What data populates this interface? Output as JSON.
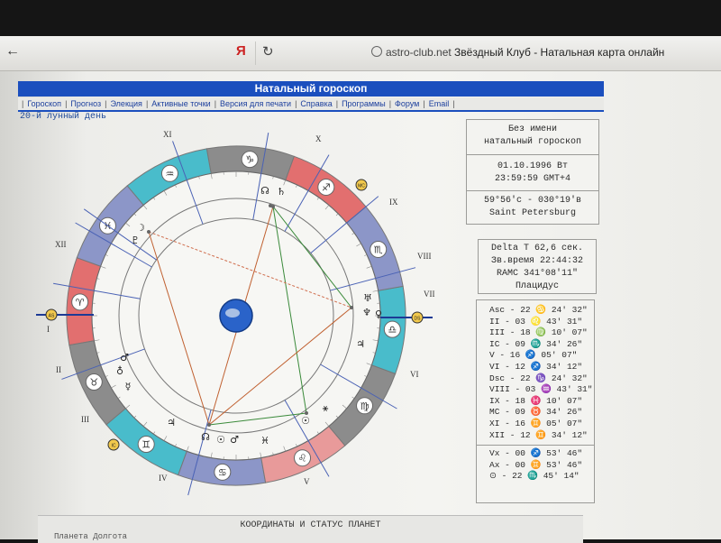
{
  "browser": {
    "title_site": "astro-club.net",
    "title_rest": "Звёздный Клуб - Натальная карта онлайн"
  },
  "page": {
    "title": "Натальный гороскоп",
    "menu": [
      "Гороскоп",
      "Прогноз",
      "Элекция",
      "Активные точки",
      "Версия для печати",
      "Справка",
      "Программы",
      "Форум",
      "Email"
    ],
    "lunar_day": "20-й лунный день"
  },
  "info": {
    "name": "Без имени",
    "type": "натальный гороскоп",
    "date": "01.10.1996 Вт",
    "time": "23:59:59",
    "gmt": "GMT+4",
    "coords": "59°56'с - 030°19'в",
    "city": "Saint Petersburg"
  },
  "astro": {
    "delta_t": "Delta T   62,6 сек.",
    "star_time": "Зв.время 22:44:32",
    "ramc": "RAMC 341°08'11\"",
    "system": "Плацидус"
  },
  "cusps": [
    "Asc - 22 ♋ 24' 32\"",
    "II - 03 ♌ 43' 31\"",
    "III - 18 ♍ 10' 07\"",
    "IC - 09 ♏ 34' 26\"",
    "V - 16 ♐ 05' 07\"",
    "VI - 12 ♐ 34' 12\"",
    "Dsc - 22 ♑ 24' 32\"",
    "VIII - 03 ♒ 43' 31\"",
    "IX - 18 ♓ 10' 07\"",
    "MC - 09 ♉ 34' 26\"",
    "XI - 16 ♊ 05' 07\"",
    "XII - 12 ♊ 34' 12\""
  ],
  "points": [
    "Vx - 00 ♐ 53' 46\"",
    "Ax - 00 ♊ 53' 46\"",
    "⊙ - 22 ♏ 45' 14\""
  ],
  "house_labels": [
    "I",
    "II",
    "III",
    "IV",
    "V",
    "VI",
    "VII",
    "VIII",
    "IX",
    "X",
    "XI",
    "XII"
  ],
  "zodiac_glyphs": [
    "♈",
    "♉",
    "♊",
    "♋",
    "♌",
    "♍",
    "♎",
    "♏",
    "♐",
    "♑",
    "♒",
    "♓"
  ],
  "zodiac_colors": [
    "#e26f6f",
    "#8c8c8c",
    "#49bccb",
    "#8c96c8",
    "#e89a9a",
    "#8c8c8c",
    "#49bccb",
    "#8c96c8",
    "#e26f6f",
    "#8c8c8c",
    "#49bccb",
    "#8c96c8"
  ],
  "chart_marks": {
    "planets_top": [
      "☊",
      "♄"
    ],
    "planets_right": [
      "♅",
      "♆",
      "♀",
      "♃"
    ],
    "planets_left": [
      "☽",
      "♇",
      "♂",
      "♁",
      "☿"
    ],
    "planets_bottom": [
      "♃",
      "☿",
      "☊",
      "♂",
      "☉"
    ],
    "mc_label": "MC",
    "ic_label": "IC",
    "as_label": "AS",
    "ds_label": "DS",
    "vx_label": "VX"
  },
  "coords_title": "КООРДИНАТЫ И СТАТУС ПЛАНЕТ",
  "coords_sub": "Планета    Долгота"
}
